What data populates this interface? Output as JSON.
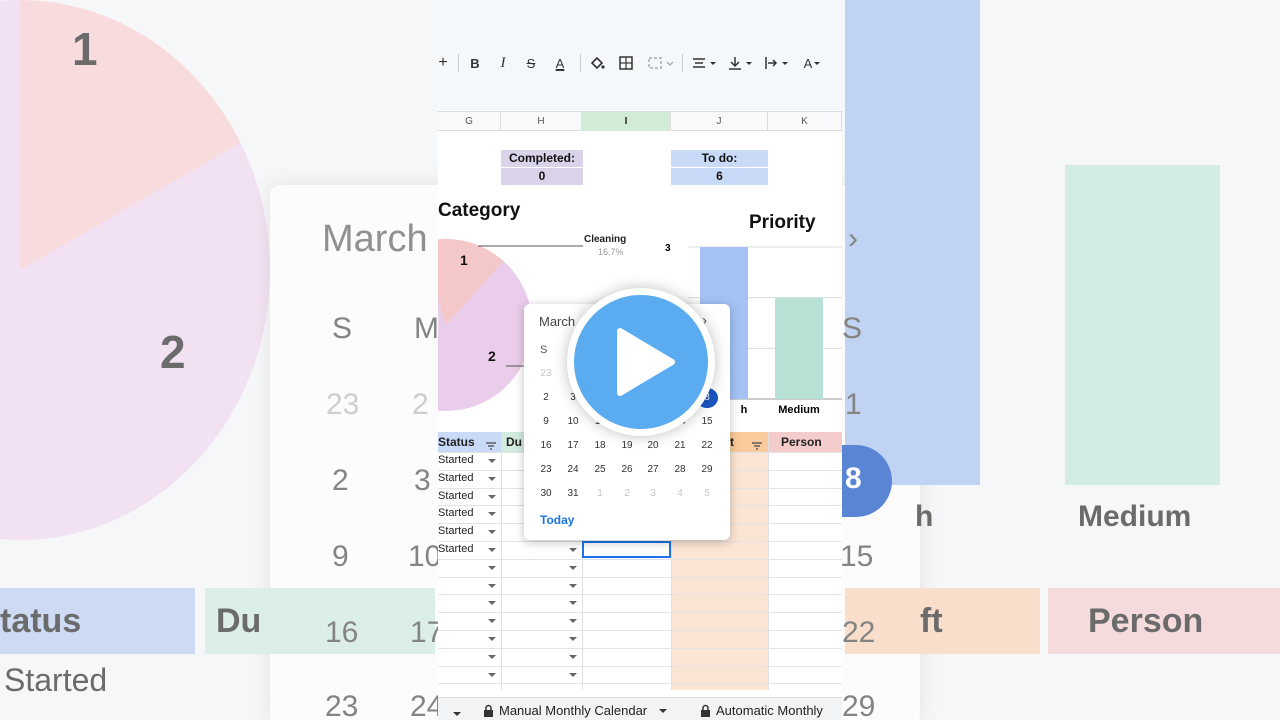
{
  "background": {
    "big_labels": {
      "pie_1": "1",
      "pie_2": "2",
      "month": "March",
      "chev": "›",
      "s1": "S",
      "m1": "M",
      "s2": "S",
      "n23": "23",
      "n24": "2",
      "n1": "1",
      "n2": "2",
      "n3": "3",
      "n8": "8",
      "h": "h",
      "medium": "Medium",
      "n9": "9",
      "n10": "10",
      "n15": "15",
      "status": "tatus",
      "du": "Du",
      "ft": "ft",
      "person": "Person",
      "n16": "16",
      "n17": "17",
      "n22": "22",
      "started": "Started",
      "n23b": "23",
      "n24b": "24",
      "n29": "29"
    }
  },
  "toolbar": {
    "plus": "+",
    "bold": "B",
    "italic": "I",
    "strike": "S",
    "text_color": "A",
    "fill_color_icon": "paint-bucket-icon",
    "borders_icon": "borders-icon",
    "merge_icon": "merge-cells-icon",
    "align_icon": "horizontal-align-icon",
    "valign_icon": "vertical-align-icon",
    "wrap_icon": "text-wrap-icon",
    "rotate": "A"
  },
  "columns": [
    "G",
    "H",
    "I",
    "J",
    "K"
  ],
  "summary": {
    "completed_label": "Completed:",
    "completed_value": "0",
    "todo_label": "To do:",
    "todo_value": "6",
    "completed_color": "#d9d2e9",
    "todo_color": "#c9daf8"
  },
  "category_chart": {
    "title": "Category",
    "label_1": "1",
    "label_2": "2",
    "cleaning_label": "Cleaning",
    "cleaning_pct": "16.7%"
  },
  "priority_chart": {
    "title": "Priority",
    "y_tick": "3",
    "x_label_high": "h",
    "x_label_medium": "Medium"
  },
  "chart_data": [
    {
      "type": "pie",
      "title": "Category",
      "slices": [
        {
          "label": "Cleaning",
          "value": 16.7,
          "color": "#f4c7c9"
        },
        {
          "label": "",
          "value": 83.3,
          "color": "#e9cdea"
        }
      ],
      "annotations": [
        "1",
        "2",
        "Cleaning 16.7%"
      ]
    },
    {
      "type": "bar",
      "title": "Priority",
      "categories": [
        "h",
        "Medium"
      ],
      "values": [
        3,
        2
      ],
      "colors": [
        "#a4c2f4",
        "#b7e1d4"
      ],
      "ylim": [
        0,
        3
      ]
    }
  ],
  "table": {
    "headers": {
      "status": "Status",
      "due": "Du",
      "left": "ft",
      "person": "Person"
    },
    "status_rows": [
      "Started",
      "Started",
      "Started",
      "Started",
      "Started",
      "Started"
    ]
  },
  "datepicker": {
    "month": "March",
    "next": "›",
    "weekday": "S",
    "rows": [
      [
        "23",
        "",
        "",
        "",
        "",
        "",
        ""
      ],
      [
        "2",
        "3",
        "",
        "",
        "",
        "",
        "8"
      ],
      [
        "9",
        "10",
        "11",
        "",
        "",
        "14",
        "15"
      ],
      [
        "16",
        "17",
        "18",
        "19",
        "20",
        "21",
        "22"
      ],
      [
        "23",
        "24",
        "25",
        "26",
        "27",
        "28",
        "29"
      ],
      [
        "30",
        "31",
        "1",
        "2",
        "3",
        "4",
        "5"
      ]
    ],
    "today_label": "Today",
    "selected_day": "8"
  },
  "sheet_tabs": {
    "manual": "Manual Monthly Calendar",
    "automatic": "Automatic Monthly"
  },
  "play_icon": "play-icon"
}
